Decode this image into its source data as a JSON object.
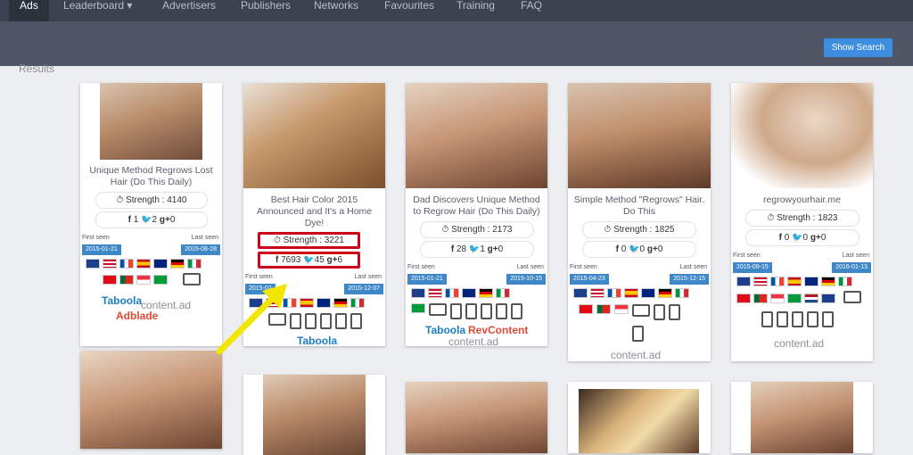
{
  "nav": {
    "items": [
      "Ads",
      "Leaderboard",
      "Advertisers",
      "Publishers",
      "Networks",
      "Favourites",
      "Training",
      "FAQ"
    ]
  },
  "toolbar": {
    "show_search": "Show Search"
  },
  "results_label": "Results",
  "labels": {
    "first_seen": "First seen",
    "last_seen": "Last seen"
  },
  "cards": [
    {
      "title": "Unique Method Regrows Lost Hair (Do This Daily)",
      "strength": "Strength : 4140",
      "fb": "1",
      "tw": "2",
      "gp": "0",
      "first_seen": "2015-01-21",
      "last_seen": "2015-08-28",
      "networks": [
        "Taboola",
        "content.ad",
        "Adblade"
      ]
    },
    {
      "title": "Best Hair Color 2015 Announced and It's a Home Dye!",
      "strength": "Strength : 3221",
      "fb": "7693",
      "tw": "45",
      "gp": "6",
      "first_seen": "2015-02",
      "last_seen": "2015-12-07",
      "networks": [
        "Taboola"
      ]
    },
    {
      "title": "Dad Discovers Unique Method to Regrow Hair (Do This Daily)",
      "strength": "Strength : 2173",
      "fb": "28",
      "tw": "1",
      "gp": "0",
      "first_seen": "2015-01-21",
      "last_seen": "2015-10-15",
      "networks": [
        "Taboola",
        "RevContent",
        "content.ad"
      ]
    },
    {
      "title": "Simple Method \"Regrows\" Hair. Do This",
      "strength": "Strength : 1825",
      "fb": "0",
      "tw": "0",
      "gp": "0",
      "first_seen": "2015-04-23",
      "last_seen": "2015-12-15",
      "networks": [
        "content.ad"
      ]
    },
    {
      "title": "regrowyourhair.me",
      "strength": "Strength : 1823",
      "fb": "0",
      "tw": "0",
      "gp": "0",
      "first_seen": "2015-09-15",
      "last_seen": "2016-01-13",
      "networks": [
        "content.ad"
      ]
    }
  ],
  "icons": {
    "clock": "clock-icon",
    "facebook": "facebook-icon",
    "twitter": "twitter-icon",
    "googleplus": "googleplus-icon",
    "arrow": "annotation-arrow"
  },
  "colors": {
    "nav_bg": "#3c4250",
    "subbar_bg": "#4f5665",
    "button": "#3d8de0",
    "date_badge": "#3e87c8",
    "highlight": "#d0021b",
    "arrow": "#f2e600"
  }
}
